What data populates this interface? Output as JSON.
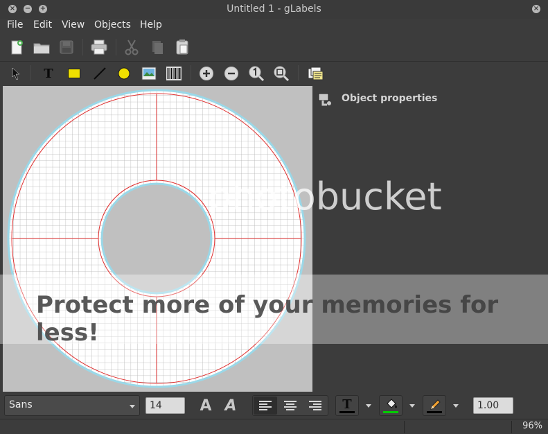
{
  "window": {
    "title": "Untitled 1 - gLabels",
    "close_glyph": "×",
    "minimize_glyph": "−",
    "maximize_glyph": "+"
  },
  "menu": {
    "items": [
      {
        "label": "File"
      },
      {
        "label": "Edit"
      },
      {
        "label": "View"
      },
      {
        "label": "Objects"
      },
      {
        "label": "Help"
      }
    ]
  },
  "toolbar_main": {
    "icons": [
      "new-document-icon",
      "open-folder-icon",
      "save-icon",
      "print-icon",
      "cut-icon",
      "copy-icon",
      "paste-icon"
    ]
  },
  "toolbar_objects": {
    "icons": [
      "arrow-select-icon",
      "text-tool-icon",
      "box-tool-icon",
      "line-tool-icon",
      "ellipse-tool-icon",
      "image-tool-icon",
      "barcode-tool-icon",
      "zoom-in-icon",
      "zoom-out-icon",
      "zoom-1to1-icon",
      "zoom-fit-icon",
      "merge-properties-icon"
    ],
    "text_tool_glyph": "T"
  },
  "side_panel": {
    "title": "Object properties"
  },
  "format_bar": {
    "font_family": "Sans",
    "font_size": "14",
    "bold_glyph": "A",
    "italic_glyph": "A",
    "text_color_glyph": "T",
    "text_color": "#000000",
    "fill_color": "#00cc00",
    "line_color": "#000000",
    "line_width": "1.00"
  },
  "status": {
    "zoom": "96%"
  },
  "watermark": {
    "brand": "photobucket",
    "tagline": "Protect more of your memories for less!"
  },
  "colors": {
    "window_bg": "#3c3c3c",
    "canvas_bg": "#c0c0c0",
    "label_fill": "#ffffff",
    "grid": "#b0b0b0",
    "guide_red": "#e03030",
    "outline_cyan": "#9ad8e8"
  }
}
